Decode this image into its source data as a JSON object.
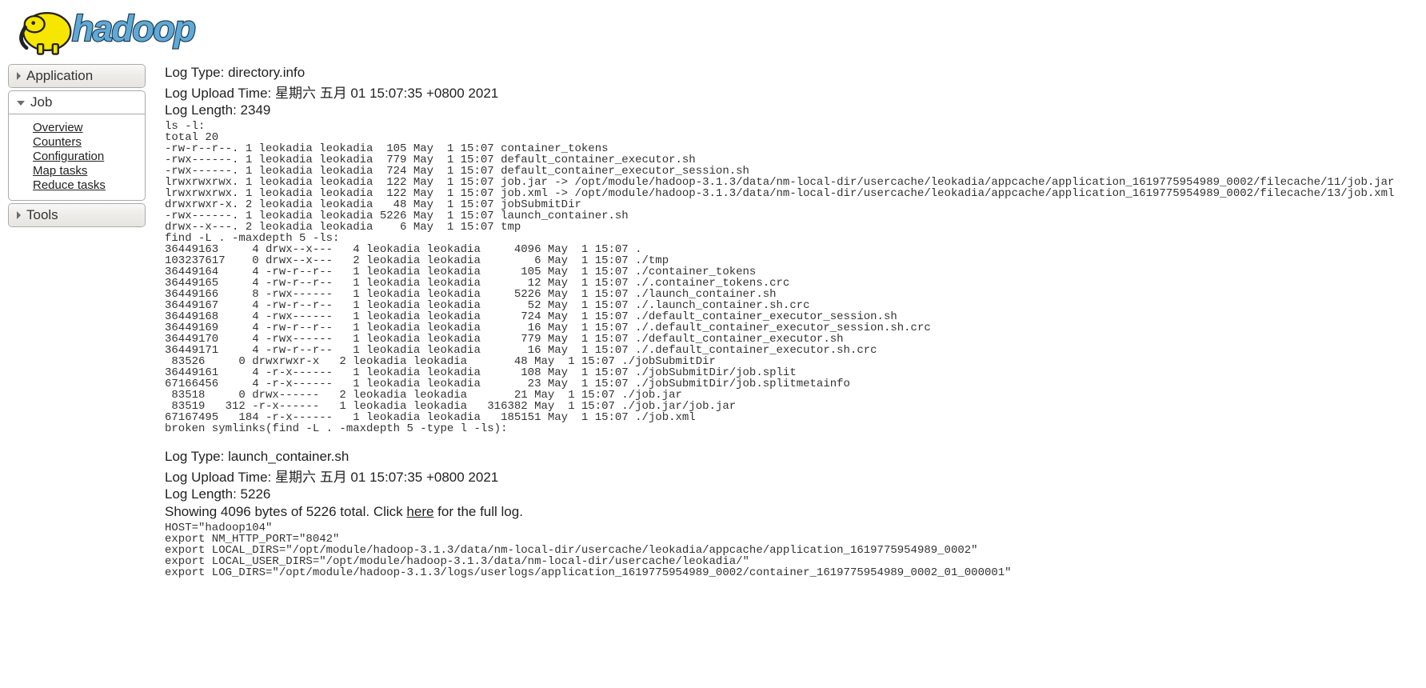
{
  "brand": {
    "name": "hadoop"
  },
  "sidebar": {
    "items": [
      {
        "label": "Application",
        "open": false
      },
      {
        "label": "Job",
        "open": true,
        "submenu": [
          {
            "label": "Overview"
          },
          {
            "label": "Counters"
          },
          {
            "label": "Configuration"
          },
          {
            "label": "Map tasks"
          },
          {
            "label": "Reduce tasks"
          }
        ]
      },
      {
        "label": "Tools",
        "open": false
      }
    ]
  },
  "logs": [
    {
      "type_label": "Log Type:",
      "type_value": "directory.info",
      "upload_label": "Log Upload Time:",
      "upload_value": "星期六 五月 01 15:07:35 +0800 2021",
      "length_label": "Log Length:",
      "length_value": "2349",
      "body": "ls -l:\ntotal 20\n-rw-r--r--. 1 leokadia leokadia  105 May  1 15:07 container_tokens\n-rwx------. 1 leokadia leokadia  779 May  1 15:07 default_container_executor.sh\n-rwx------. 1 leokadia leokadia  724 May  1 15:07 default_container_executor_session.sh\nlrwxrwxrwx. 1 leokadia leokadia  122 May  1 15:07 job.jar -> /opt/module/hadoop-3.1.3/data/nm-local-dir/usercache/leokadia/appcache/application_1619775954989_0002/filecache/11/job.jar\nlrwxrwxrwx. 1 leokadia leokadia  122 May  1 15:07 job.xml -> /opt/module/hadoop-3.1.3/data/nm-local-dir/usercache/leokadia/appcache/application_1619775954989_0002/filecache/13/job.xml\ndrwxrwxr-x. 2 leokadia leokadia   48 May  1 15:07 jobSubmitDir\n-rwx------. 1 leokadia leokadia 5226 May  1 15:07 launch_container.sh\ndrwx--x---. 2 leokadia leokadia    6 May  1 15:07 tmp\nfind -L . -maxdepth 5 -ls:\n36449163     4 drwx--x---   4 leokadia leokadia     4096 May  1 15:07 .\n103237617    0 drwx--x---   2 leokadia leokadia        6 May  1 15:07 ./tmp\n36449164     4 -rw-r--r--   1 leokadia leokadia      105 May  1 15:07 ./container_tokens\n36449165     4 -rw-r--r--   1 leokadia leokadia       12 May  1 15:07 ./.container_tokens.crc\n36449166     8 -rwx------   1 leokadia leokadia     5226 May  1 15:07 ./launch_container.sh\n36449167     4 -rw-r--r--   1 leokadia leokadia       52 May  1 15:07 ./.launch_container.sh.crc\n36449168     4 -rwx------   1 leokadia leokadia      724 May  1 15:07 ./default_container_executor_session.sh\n36449169     4 -rw-r--r--   1 leokadia leokadia       16 May  1 15:07 ./.default_container_executor_session.sh.crc\n36449170     4 -rwx------   1 leokadia leokadia      779 May  1 15:07 ./default_container_executor.sh\n36449171     4 -rw-r--r--   1 leokadia leokadia       16 May  1 15:07 ./.default_container_executor.sh.crc\n 83526     0 drwxrwxr-x   2 leokadia leokadia       48 May  1 15:07 ./jobSubmitDir\n36449161     4 -r-x------   1 leokadia leokadia      108 May  1 15:07 ./jobSubmitDir/job.split\n67166456     4 -r-x------   1 leokadia leokadia       23 May  1 15:07 ./jobSubmitDir/job.splitmetainfo\n 83518     0 drwx------   2 leokadia leokadia       21 May  1 15:07 ./job.jar\n 83519   312 -r-x------   1 leokadia leokadia   316382 May  1 15:07 ./job.jar/job.jar\n67167495   184 -r-x------   1 leokadia leokadia   185151 May  1 15:07 ./job.xml\nbroken symlinks(find -L . -maxdepth 5 -type l -ls):"
    },
    {
      "type_label": "Log Type:",
      "type_value": "launch_container.sh",
      "upload_label": "Log Upload Time:",
      "upload_value": "星期六 五月 01 15:07:35 +0800 2021",
      "length_label": "Log Length:",
      "length_value": "5226",
      "partial_prefix": "Showing 4096 bytes of 5226 total. Click ",
      "partial_link": "here",
      "partial_suffix": " for the full log.",
      "body": "HOST=\"hadoop104\"\nexport NM_HTTP_PORT=\"8042\"\nexport LOCAL_DIRS=\"/opt/module/hadoop-3.1.3/data/nm-local-dir/usercache/leokadia/appcache/application_1619775954989_0002\"\nexport LOCAL_USER_DIRS=\"/opt/module/hadoop-3.1.3/data/nm-local-dir/usercache/leokadia/\"\nexport LOG_DIRS=\"/opt/module/hadoop-3.1.3/logs/userlogs/application_1619775954989_0002/container_1619775954989_0002_01_000001\""
    }
  ]
}
